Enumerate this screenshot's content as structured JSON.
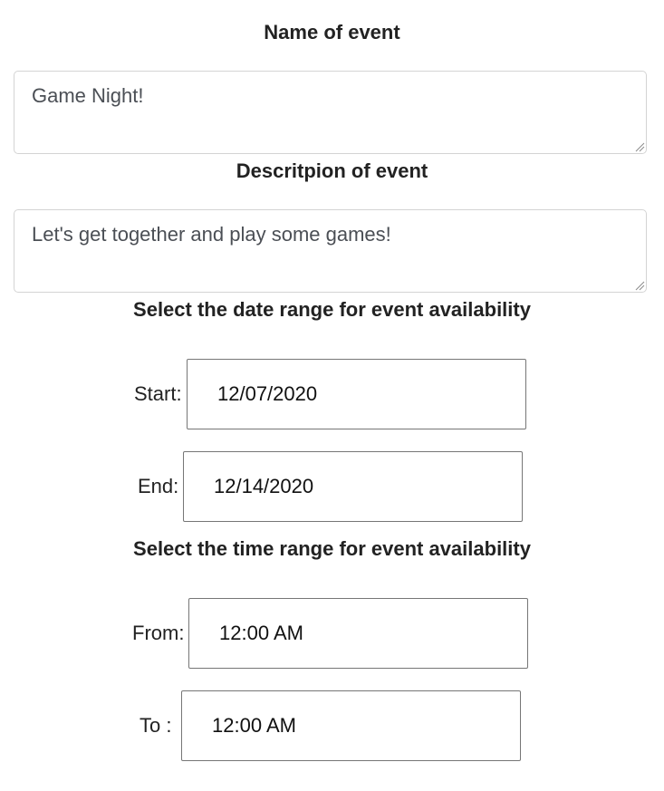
{
  "event_name": {
    "heading": "Name of event",
    "value": "Game Night!"
  },
  "event_description": {
    "heading": "Descritpion of event",
    "value": "Let's get together and play some games!"
  },
  "date_range": {
    "heading": "Select the date range for event availability",
    "start_label": "Start:",
    "start_value": "12/07/2020",
    "end_label": "End:",
    "end_value": "12/14/2020"
  },
  "time_range": {
    "heading": "Select the time range for event availability",
    "from_label": "From:",
    "from_value": "12:00 AM",
    "to_label": "To :",
    "to_value": "12:00 AM"
  },
  "icons": {
    "resize_grip": "resize-grip-icon"
  }
}
